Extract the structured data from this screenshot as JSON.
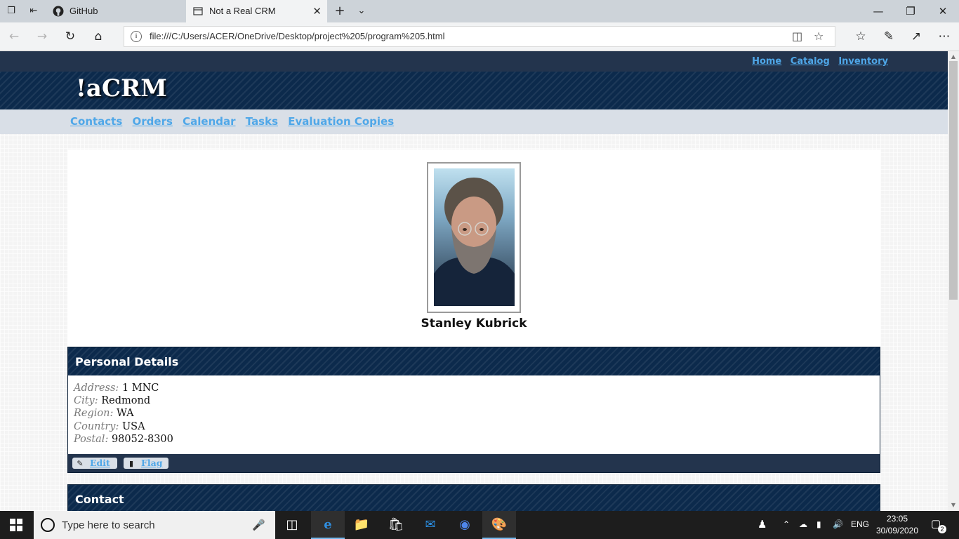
{
  "browser": {
    "tabs": [
      {
        "label": "GitHub",
        "icon": "github-icon"
      },
      {
        "label": "Not a Real CRM",
        "icon": "page-icon",
        "active": true
      }
    ],
    "url": "file:///C:/Users/ACER/OneDrive/Desktop/project%205/program%205.html"
  },
  "site": {
    "top_links": [
      "Home",
      "Catalog",
      "Inventory"
    ],
    "logo": "!aCRM",
    "nav_links": [
      "Contacts",
      "Orders",
      "Calendar",
      "Tasks",
      "Evaluation Copies"
    ]
  },
  "contact": {
    "name": "Stanley Kubrick"
  },
  "personal_details": {
    "title": "Personal Details",
    "fields": [
      {
        "label": "Address:",
        "value": "1 MNC"
      },
      {
        "label": "City:",
        "value": "Redmond"
      },
      {
        "label": "Region:",
        "value": "WA"
      },
      {
        "label": "Country:",
        "value": "USA"
      },
      {
        "label": "Postal:",
        "value": "98052-8300"
      }
    ],
    "actions": [
      {
        "label": "Edit",
        "icon": "pencil-icon"
      },
      {
        "label": "Flag",
        "icon": "bookmark-icon"
      }
    ]
  },
  "contact_panel": {
    "title": "Contact"
  },
  "taskbar": {
    "search_placeholder": "Type here to search",
    "language": "ENG",
    "time": "23:05",
    "date": "30/09/2020",
    "notification_count": "2"
  },
  "colors": {
    "banner": "#0c2a4c",
    "strip": "#23344d",
    "link": "#4fa7e8",
    "subnav_bg": "#d9dfe7"
  }
}
